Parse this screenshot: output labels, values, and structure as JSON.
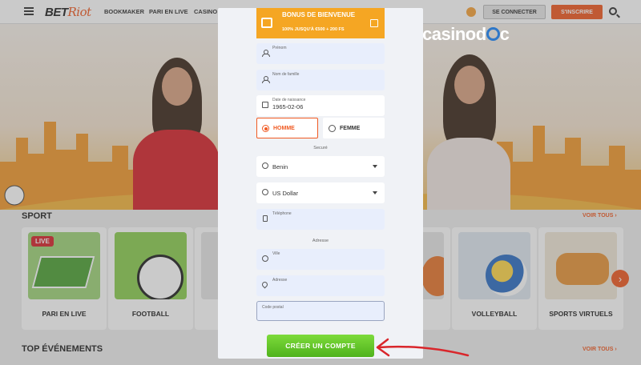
{
  "header": {
    "logo_bet": "BET",
    "logo_riot": "Riot",
    "nav": [
      "BOOKMAKER",
      "PARI EN LIVE",
      "CASINO"
    ],
    "login_label": "SE CONNECTER",
    "signup_label": "S'INSCRIRE",
    "icons": [
      "menu-icon",
      "coin-icon",
      "search-icon"
    ]
  },
  "watermark": {
    "pre": "casinod",
    "post": "c"
  },
  "sections": {
    "sport_title": "SPORT",
    "sport_link": "VOIR TOUS ›",
    "top_title": "TOP ÉVÉNEMENTS",
    "top_link": "VOIR TOUS ›"
  },
  "cards": [
    {
      "label": "PARI EN LIVE",
      "badge": "LIVE"
    },
    {
      "label": "FOOTBALL"
    },
    {
      "label": ""
    },
    {
      "label": ""
    },
    {
      "label": ""
    },
    {
      "label": "VOLLEYBALL"
    },
    {
      "label": "SPORTS VIRTUELS"
    }
  ],
  "form": {
    "bonus_title": "BONUS DE BIENVENUE",
    "bonus_sub": "100% JUSQU'À €500 + 200 FS",
    "first_name_label": "Prénom",
    "last_name_label": "Nom de famille",
    "birthdate_label": "Date de naissance",
    "birthdate_value": "1965-02-06",
    "gender_male": "HOMME",
    "gender_female": "FEMME",
    "security_label": "Securé",
    "country_value": "Benin",
    "currency_value": "US Dollar",
    "phone_label": "Téléphone",
    "address_section": "Adresse",
    "city_label": "Ville",
    "address_label": "Adresse",
    "postal_label": "Code postal",
    "submit_label": "CRÉER UN COMPTE"
  },
  "colors": {
    "accent": "#f05a22",
    "bonus": "#f5a623",
    "submit": "#5bbf22",
    "field": "#e8eefc",
    "annotation_arrow": "#d9262b"
  }
}
